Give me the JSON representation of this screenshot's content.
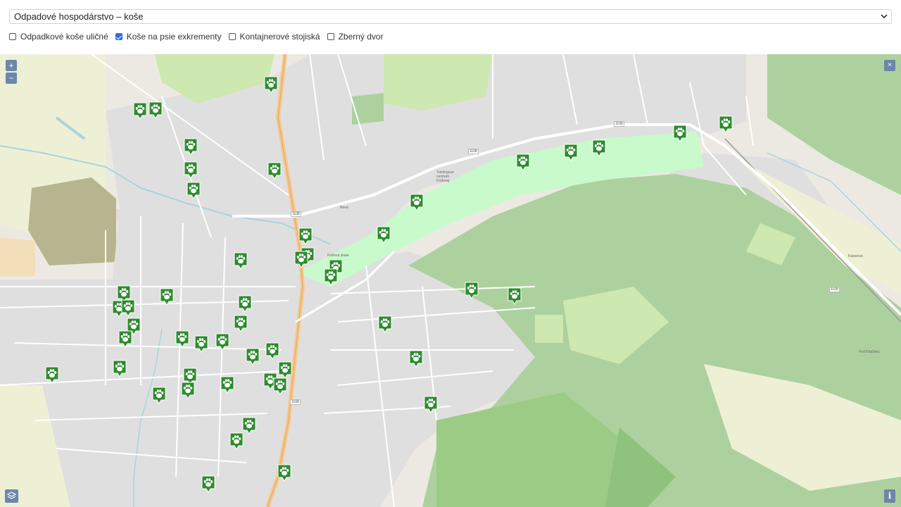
{
  "layer_select": {
    "value": "Odpadové hospodárstvo – koše"
  },
  "filters": [
    {
      "label": "Odpadkové koše uličné",
      "checked": false
    },
    {
      "label": "Koše na psie exkrementy",
      "checked": true
    },
    {
      "label": "Kontajnerové stojiská",
      "checked": false
    },
    {
      "label": "Zberný dvor",
      "checked": false
    }
  ],
  "map_controls": {
    "zoom_in": "+",
    "zoom_out": "−",
    "close": "×",
    "info": "i"
  },
  "map_labels": {
    "route_1108_a": "1108",
    "route_1108_b": "1108",
    "route_1108_c": "1108",
    "route_1108_d": "1108",
    "route_1108_e": "1108",
    "sports": "Tréningové centrum Kráľovej",
    "park": "Kráľová skala",
    "street_nova": "Nová",
    "ponec": "Kopanice",
    "lokal": "Pod Kľačianu"
  },
  "colors": {
    "marker_green": "#2e8b2e",
    "forest": "#add19e",
    "forest_dark": "#8fc27c",
    "meadow": "#cde8b0",
    "residential": "#e0dfdf",
    "road_main": "#f6c78a",
    "water": "#aad3df",
    "park": "#c8facc"
  },
  "marker_icon": "dog-paw-icon",
  "marker_count": 53
}
